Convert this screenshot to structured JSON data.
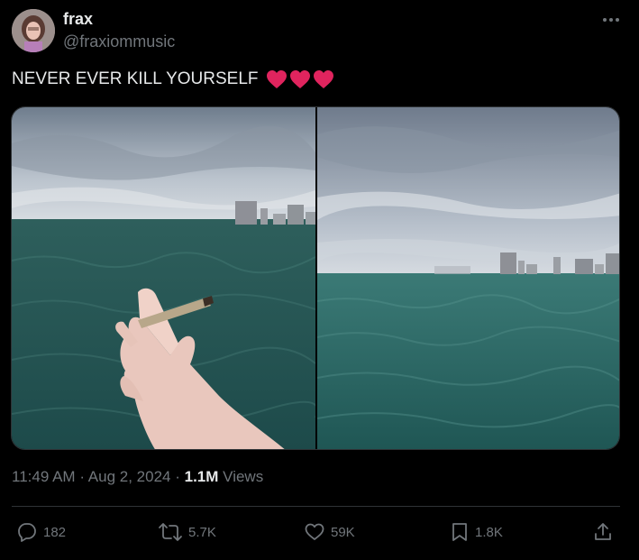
{
  "author": {
    "display_name": "frax",
    "handle": "@fraxiommusic"
  },
  "tweet": {
    "text": "NEVER EVER KILL YOURSELF",
    "emojis": [
      "red-heart",
      "red-heart",
      "red-heart"
    ],
    "photos": [
      {
        "alt_icon": "photo-hand-holding-joint-over-lake"
      },
      {
        "alt_icon": "photo-lake-with-city-skyline"
      }
    ]
  },
  "meta": {
    "time": "11:49 AM",
    "separator": "·",
    "date": "Aug 2, 2024",
    "views_count": "1.1M",
    "views_label": "Views"
  },
  "actions": {
    "replies": "182",
    "reposts": "5.7K",
    "likes": "59K",
    "bookmarks": "1.8K"
  },
  "colors": {
    "background": "#000000",
    "primary_text": "#e7e9ea",
    "secondary_text": "#71767b",
    "divider": "#2f3336",
    "heart": "#e0245e"
  }
}
